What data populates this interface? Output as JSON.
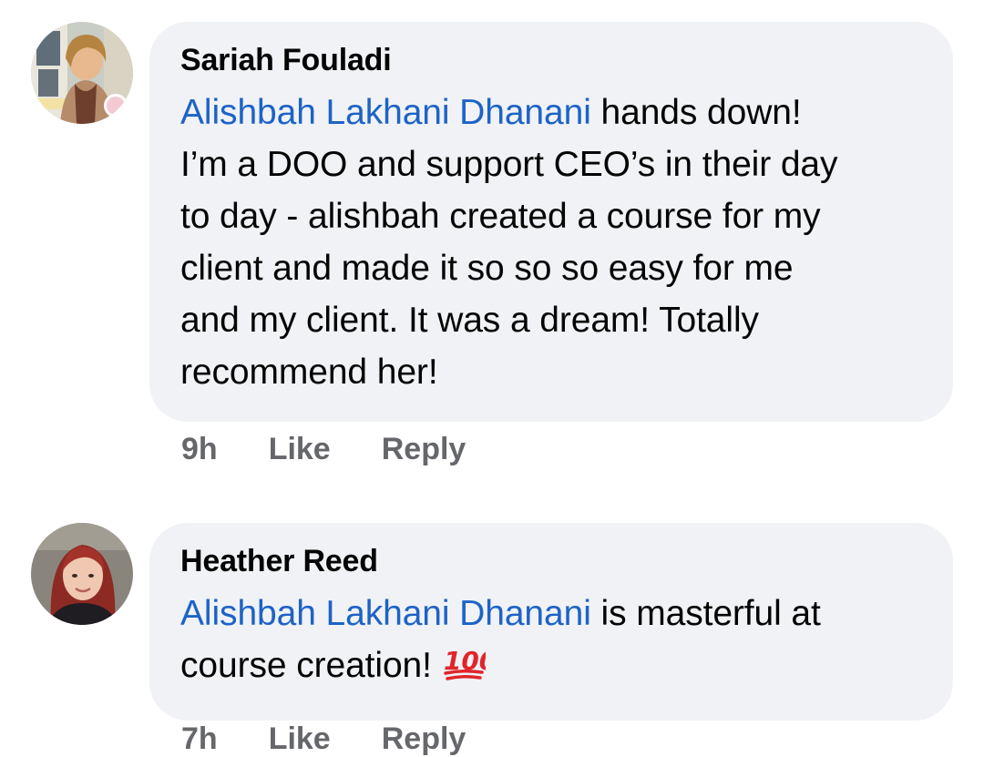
{
  "comments": [
    {
      "author": "Sariah Fouladi",
      "mention": "Alishbah Lakhani Dhanani",
      "text_lines": [
        " hands down!",
        "I’m a DOO and support CEO’s in their day",
        "to day - alishbah created a course for my",
        "client and made it so so so easy for me",
        "and my client. It was a dream! Totally",
        "recommend her!"
      ],
      "time": "9h",
      "like_label": "Like",
      "reply_label": "Reply"
    },
    {
      "author": "Heather Reed",
      "mention": "Alishbah Lakhani Dhanani",
      "text_lines": [
        " is masterful at",
        "course creation! "
      ],
      "emoji": "hundred-points-icon",
      "time": "7h",
      "like_label": "Like",
      "reply_label": "Reply"
    }
  ],
  "colors": {
    "bubble": "#f0f2f5",
    "mention": "#1d63c7",
    "meta": "#65676b",
    "text": "#050505"
  }
}
